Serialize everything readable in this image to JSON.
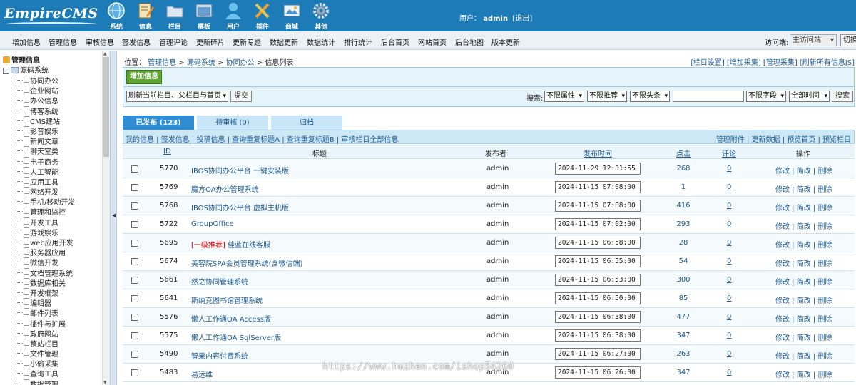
{
  "header": {
    "logo": "EmpireCMS",
    "nav": [
      {
        "label": "系统",
        "icon": "globe-icon"
      },
      {
        "label": "信息",
        "icon": "edit-icon"
      },
      {
        "label": "栏目",
        "icon": "folder-icon"
      },
      {
        "label": "模板",
        "icon": "template-icon"
      },
      {
        "label": "用户",
        "icon": "user-icon"
      },
      {
        "label": "插件",
        "icon": "tools-icon"
      },
      {
        "label": "商城",
        "icon": "mall-icon"
      },
      {
        "label": "其他",
        "icon": "gear-icon"
      }
    ],
    "user_label": "用户：",
    "user_name": "admin",
    "logout": "[退出]"
  },
  "menubar": {
    "items": [
      "增加信息",
      "管理信息",
      "审核信息",
      "签发信息",
      "管理评论",
      "更新碎片",
      "更新专题",
      "数据更新",
      "数据统计",
      "排行统计",
      "后台首页",
      "网站首页",
      "后台地图",
      "版本更新"
    ],
    "visit_label": "访问端:",
    "visit_value": "主访问端",
    "switch_label": "切换"
  },
  "tree": {
    "root": "管理信息",
    "node": "源码系统",
    "items": [
      "协同办公",
      "企业网站",
      "办公信息",
      "博客系统",
      "CMS建站",
      "影音娱乐",
      "新闻文章",
      "聊天室类",
      "电子商务",
      "人工智能",
      "应用工具",
      "网络开发",
      "手机/移动开发",
      "管理和监控",
      "开发工具",
      "游戏娱乐",
      "web应用开发",
      "服务器应用",
      "微信开发",
      "文档管理系统",
      "数据库相关",
      "开发框架",
      "编辑器",
      "邮件列表",
      "插件与扩展",
      "政府网站",
      "整站栏目",
      "文件管理",
      "小偷采集",
      "查询工具",
      "数据管理"
    ]
  },
  "main": {
    "crumb_prefix": "位置：",
    "crumb": [
      "管理信息",
      "源码系统",
      "协同办公"
    ],
    "crumb_tail": "信息列表",
    "crumb_right": "[栏目设置] [增加采集] [管理采集] [刷新所有信息JS]",
    "add_button": "增加信息",
    "refresh_select": "刷新当前栏目、父栏目与首页",
    "submit_button": "提交",
    "search_label": "搜索:",
    "filter1": "不限属性",
    "filter2": "不限推荐",
    "filter3": "不限头条",
    "field_select": "不限字段",
    "time_select": "全部时间",
    "search_button": "搜索",
    "search_value": "",
    "tabs": [
      "已发布 (123)",
      "待审核 (0)",
      "归档"
    ],
    "sub_left": "我的信息 | 签发信息 | 投稿信息 | 查询重复标题A | 查询重复标题B | 审核栏目全部信息",
    "sub_right": "管理附件 | 更新数据 | 预览首页 | 预览栏目",
    "columns": {
      "id": "ID",
      "title": "标题",
      "author": "发布者",
      "time": "发布时间",
      "clicks": "点击",
      "comments": "评论",
      "ops": "操作"
    },
    "op_links": "修改 | 简改 | 删除",
    "rows": [
      {
        "id": "5770",
        "tag": "",
        "title": "IBOS协同办公平台 一键安装版",
        "author": "admin",
        "time": "2024-11-29 12:01:55",
        "clicks": "268",
        "comments": "0"
      },
      {
        "id": "5769",
        "tag": "",
        "title": "魔方OA办公管理系统",
        "author": "admin",
        "time": "2024-11-15 07:08:00",
        "clicks": "1",
        "comments": "0"
      },
      {
        "id": "5768",
        "tag": "",
        "title": "IBOS协同办公平台 虚拟主机版",
        "author": "admin",
        "time": "2024-11-15 07:08:00",
        "clicks": "416",
        "comments": "0"
      },
      {
        "id": "5722",
        "tag": "",
        "title": "GroupOffice",
        "author": "admin",
        "time": "2024-11-15 07:02:00",
        "clicks": "293",
        "comments": "0"
      },
      {
        "id": "5695",
        "tag": "[一级推荐]",
        "title": "佳蓝在线客服",
        "author": "admin",
        "time": "2024-11-15 06:58:00",
        "clicks": "28",
        "comments": "0"
      },
      {
        "id": "5674",
        "tag": "",
        "title": "美容院SPA会员管理系统(含微信端)",
        "author": "admin",
        "time": "2024-11-15 06:55:00",
        "clicks": "54",
        "comments": "0"
      },
      {
        "id": "5661",
        "tag": "",
        "title": "然之协同管理系统",
        "author": "admin",
        "time": "2024-11-15 06:53:00",
        "clicks": "300",
        "comments": "0"
      },
      {
        "id": "5641",
        "tag": "",
        "title": "斯纳克图书馆管理系统",
        "author": "admin",
        "time": "2024-11-15 06:50:00",
        "clicks": "85",
        "comments": "0"
      },
      {
        "id": "5576",
        "tag": "",
        "title": "懒人工作通OA Access版",
        "author": "admin",
        "time": "2024-11-15 06:38:00",
        "clicks": "477",
        "comments": "0"
      },
      {
        "id": "5575",
        "tag": "",
        "title": "懒人工作通OA SqlServer版",
        "author": "admin",
        "time": "2024-11-15 06:38:00",
        "clicks": "347",
        "comments": "0"
      },
      {
        "id": "5490",
        "tag": "",
        "title": "智果内容付费系统",
        "author": "admin",
        "time": "2024-11-15 06:27:00",
        "clicks": "263",
        "comments": "0"
      },
      {
        "id": "5483",
        "tag": "",
        "title": "易运维",
        "author": "admin",
        "time": "2024-11-15 06:26:00",
        "clicks": "347",
        "comments": "0"
      }
    ]
  },
  "watermark": "https://www.huzhan.com/ishop54260",
  "colors": {
    "header": "#1d7bb8",
    "link": "#1d5b94",
    "tab_active": "#2f8ed3",
    "add_button": "#5fa633"
  }
}
